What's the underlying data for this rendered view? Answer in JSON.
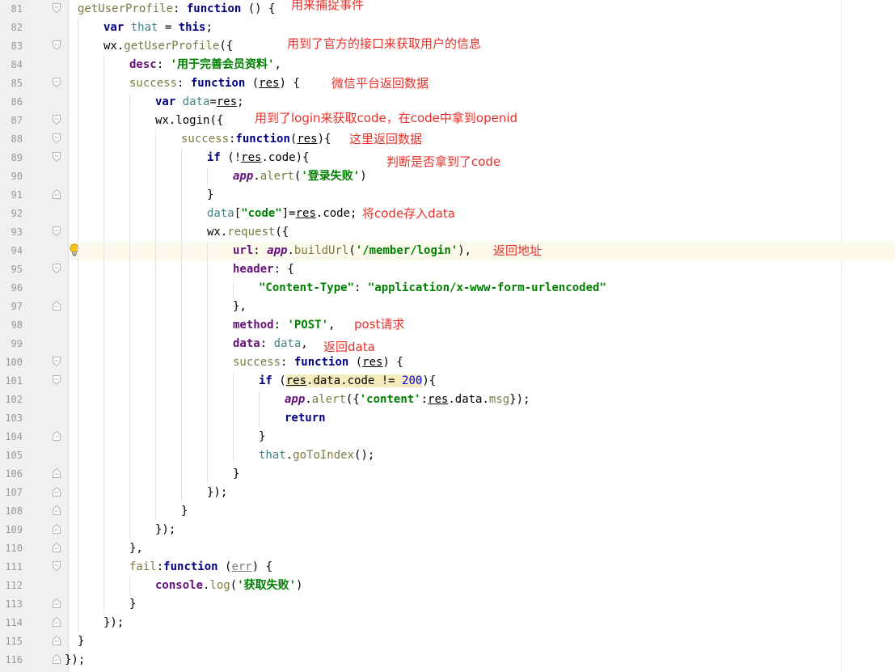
{
  "lines": [
    {
      "n": "81",
      "indent": 0,
      "tokens": [
        {
          "t": "getUserProfile",
          "c": "fn"
        },
        {
          "t": ": ",
          "c": "plain"
        },
        {
          "t": "function",
          "c": "kw"
        },
        {
          "t": " () {",
          "c": "plain"
        }
      ],
      "fold": "open"
    },
    {
      "n": "82",
      "indent": 1,
      "tokens": [
        {
          "t": "var ",
          "c": "kw"
        },
        {
          "t": "that",
          "c": "var"
        },
        {
          "t": " = ",
          "c": "plain"
        },
        {
          "t": "this",
          "c": "kw"
        },
        {
          "t": ";",
          "c": "plain"
        }
      ]
    },
    {
      "n": "83",
      "indent": 1,
      "tokens": [
        {
          "t": "wx.",
          "c": "plain"
        },
        {
          "t": "getUserProfile",
          "c": "meth"
        },
        {
          "t": "({",
          "c": "plain"
        }
      ],
      "fold": "open"
    },
    {
      "n": "84",
      "indent": 2,
      "tokens": [
        {
          "t": "desc",
          "c": "prop"
        },
        {
          "t": ": ",
          "c": "plain"
        },
        {
          "t": "'用于完善会员资料'",
          "c": "str"
        },
        {
          "t": ",",
          "c": "plain"
        }
      ]
    },
    {
      "n": "85",
      "indent": 2,
      "tokens": [
        {
          "t": "success",
          "c": "meth"
        },
        {
          "t": ": ",
          "c": "plain"
        },
        {
          "t": "function",
          "c": "kw"
        },
        {
          "t": " (",
          "c": "plain"
        },
        {
          "t": "res",
          "c": "ul"
        },
        {
          "t": ") {",
          "c": "plain"
        }
      ],
      "fold": "open"
    },
    {
      "n": "86",
      "indent": 3,
      "tokens": [
        {
          "t": "var ",
          "c": "kw"
        },
        {
          "t": "data",
          "c": "var"
        },
        {
          "t": "=",
          "c": "plain"
        },
        {
          "t": "res",
          "c": "ul"
        },
        {
          "t": ";",
          "c": "plain"
        }
      ]
    },
    {
      "n": "87",
      "indent": 3,
      "tokens": [
        {
          "t": "wx.login",
          "c": "plain"
        },
        {
          "t": "({",
          "c": "plain"
        }
      ],
      "fold": "open"
    },
    {
      "n": "88",
      "indent": 4,
      "tokens": [
        {
          "t": "success",
          "c": "meth"
        },
        {
          "t": ":",
          "c": "plain"
        },
        {
          "t": "function",
          "c": "kw"
        },
        {
          "t": "(",
          "c": "plain"
        },
        {
          "t": "res",
          "c": "ul"
        },
        {
          "t": "){",
          "c": "plain"
        }
      ],
      "fold": "open"
    },
    {
      "n": "89",
      "indent": 5,
      "tokens": [
        {
          "t": "if",
          "c": "kw"
        },
        {
          "t": " (!",
          "c": "plain"
        },
        {
          "t": "res",
          "c": "ul"
        },
        {
          "t": ".code){",
          "c": "plain"
        }
      ],
      "fold": "open"
    },
    {
      "n": "90",
      "indent": 6,
      "tokens": [
        {
          "t": "app",
          "c": "global"
        },
        {
          "t": ".",
          "c": "plain"
        },
        {
          "t": "alert",
          "c": "meth"
        },
        {
          "t": "(",
          "c": "plain"
        },
        {
          "t": "'登录失败'",
          "c": "str"
        },
        {
          "t": ")",
          "c": "plain"
        }
      ]
    },
    {
      "n": "91",
      "indent": 5,
      "tokens": [
        {
          "t": "}",
          "c": "plain"
        }
      ],
      "fold": "close"
    },
    {
      "n": "92",
      "indent": 5,
      "tokens": [
        {
          "t": "data",
          "c": "var"
        },
        {
          "t": "[",
          "c": "plain"
        },
        {
          "t": "\"code\"",
          "c": "str"
        },
        {
          "t": "]=",
          "c": "plain"
        },
        {
          "t": "res",
          "c": "ul"
        },
        {
          "t": ".code;",
          "c": "plain"
        }
      ]
    },
    {
      "n": "93",
      "indent": 5,
      "tokens": [
        {
          "t": "wx.",
          "c": "plain"
        },
        {
          "t": "request",
          "c": "meth"
        },
        {
          "t": "({",
          "c": "plain"
        }
      ],
      "fold": "open"
    },
    {
      "n": "94",
      "indent": 6,
      "tokens": [
        {
          "t": "url",
          "c": "prop"
        },
        {
          "t": ": ",
          "c": "plain"
        },
        {
          "t": "app",
          "c": "global"
        },
        {
          "t": ".",
          "c": "plain"
        },
        {
          "t": "buildUrl",
          "c": "meth"
        },
        {
          "t": "(",
          "c": "plain"
        },
        {
          "t": "'/member/login'",
          "c": "str"
        },
        {
          "t": "),",
          "c": "plain"
        }
      ],
      "highlight": true,
      "bulb": true
    },
    {
      "n": "95",
      "indent": 6,
      "tokens": [
        {
          "t": "header",
          "c": "prop"
        },
        {
          "t": ": {",
          "c": "plain"
        }
      ],
      "fold": "open"
    },
    {
      "n": "96",
      "indent": 7,
      "tokens": [
        {
          "t": "\"Content-Type\"",
          "c": "str"
        },
        {
          "t": ": ",
          "c": "plain"
        },
        {
          "t": "\"application/x-www-form-urlencoded\"",
          "c": "str"
        }
      ]
    },
    {
      "n": "97",
      "indent": 6,
      "tokens": [
        {
          "t": "},",
          "c": "plain"
        }
      ],
      "fold": "close"
    },
    {
      "n": "98",
      "indent": 6,
      "tokens": [
        {
          "t": "method",
          "c": "prop"
        },
        {
          "t": ": ",
          "c": "plain"
        },
        {
          "t": "'POST'",
          "c": "str"
        },
        {
          "t": ",",
          "c": "plain"
        }
      ]
    },
    {
      "n": "99",
      "indent": 6,
      "tokens": [
        {
          "t": "data",
          "c": "prop"
        },
        {
          "t": ": ",
          "c": "plain"
        },
        {
          "t": "data",
          "c": "var"
        },
        {
          "t": ",",
          "c": "plain"
        }
      ]
    },
    {
      "n": "100",
      "indent": 6,
      "tokens": [
        {
          "t": "success",
          "c": "meth"
        },
        {
          "t": ": ",
          "c": "plain"
        },
        {
          "t": "function",
          "c": "kw"
        },
        {
          "t": " (",
          "c": "plain"
        },
        {
          "t": "res",
          "c": "ul"
        },
        {
          "t": ") {",
          "c": "plain"
        }
      ],
      "fold": "open"
    },
    {
      "n": "101",
      "indent": 7,
      "tokens": [
        {
          "t": "if",
          "c": "kw"
        },
        {
          "t": " (",
          "c": "plain"
        },
        {
          "t": "res",
          "c": "ul hilite"
        },
        {
          "t": ".data.code != ",
          "c": "plain hilite"
        },
        {
          "t": "200",
          "c": "num hilite"
        },
        {
          "t": "){",
          "c": "plain"
        }
      ],
      "fold": "open"
    },
    {
      "n": "102",
      "indent": 8,
      "tokens": [
        {
          "t": "app",
          "c": "global"
        },
        {
          "t": ".",
          "c": "plain"
        },
        {
          "t": "alert",
          "c": "meth"
        },
        {
          "t": "({",
          "c": "plain"
        },
        {
          "t": "'content'",
          "c": "str"
        },
        {
          "t": ":",
          "c": "plain"
        },
        {
          "t": "res",
          "c": "ul"
        },
        {
          "t": ".data.",
          "c": "plain"
        },
        {
          "t": "msg",
          "c": "meth"
        },
        {
          "t": "});",
          "c": "plain"
        }
      ]
    },
    {
      "n": "103",
      "indent": 8,
      "tokens": [
        {
          "t": "return",
          "c": "kw"
        }
      ]
    },
    {
      "n": "104",
      "indent": 7,
      "tokens": [
        {
          "t": "}",
          "c": "plain"
        }
      ],
      "fold": "close"
    },
    {
      "n": "105",
      "indent": 7,
      "tokens": [
        {
          "t": "that",
          "c": "var"
        },
        {
          "t": ".",
          "c": "plain"
        },
        {
          "t": "goToIndex",
          "c": "meth"
        },
        {
          "t": "();",
          "c": "plain"
        }
      ]
    },
    {
      "n": "106",
      "indent": 6,
      "tokens": [
        {
          "t": "}",
          "c": "plain"
        }
      ],
      "fold": "close"
    },
    {
      "n": "107",
      "indent": 5,
      "tokens": [
        {
          "t": "});",
          "c": "plain"
        }
      ],
      "fold": "close"
    },
    {
      "n": "108",
      "indent": 4,
      "tokens": [
        {
          "t": "}",
          "c": "plain"
        }
      ],
      "fold": "close"
    },
    {
      "n": "109",
      "indent": 3,
      "tokens": [
        {
          "t": "});",
          "c": "plain"
        }
      ],
      "fold": "close"
    },
    {
      "n": "110",
      "indent": 2,
      "tokens": [
        {
          "t": "},",
          "c": "plain"
        }
      ],
      "fold": "close"
    },
    {
      "n": "111",
      "indent": 2,
      "tokens": [
        {
          "t": "fail",
          "c": "meth"
        },
        {
          "t": ":",
          "c": "plain"
        },
        {
          "t": "function",
          "c": "kw"
        },
        {
          "t": " (",
          "c": "plain"
        },
        {
          "t": "err",
          "c": "ul-gray"
        },
        {
          "t": ") {",
          "c": "plain"
        }
      ],
      "fold": "open"
    },
    {
      "n": "112",
      "indent": 3,
      "tokens": [
        {
          "t": "console",
          "c": "prop"
        },
        {
          "t": ".",
          "c": "plain"
        },
        {
          "t": "log",
          "c": "meth"
        },
        {
          "t": "(",
          "c": "plain"
        },
        {
          "t": "'获取失败'",
          "c": "str"
        },
        {
          "t": ")",
          "c": "plain"
        }
      ]
    },
    {
      "n": "113",
      "indent": 2,
      "tokens": [
        {
          "t": "}",
          "c": "plain"
        }
      ],
      "fold": "close"
    },
    {
      "n": "114",
      "indent": 1,
      "tokens": [
        {
          "t": "});",
          "c": "plain"
        }
      ],
      "fold": "close"
    },
    {
      "n": "115",
      "indent": 0,
      "tokens": [
        {
          "t": "}",
          "c": "plain"
        }
      ],
      "fold": "close"
    },
    {
      "n": "116",
      "indent": -0.5,
      "tokens": [
        {
          "t": "});",
          "c": "plain"
        }
      ],
      "fold": "close"
    }
  ],
  "annotations": [
    {
      "line": "81",
      "text": "用来捕捉事件"
    },
    {
      "line": "83",
      "text": "用到了官方的接口来获取用户的信息"
    },
    {
      "line": "85",
      "text": "微信平台返回数据"
    },
    {
      "line": "87",
      "text": "用到了login来获取code，在code中拿到openid"
    },
    {
      "line": "88",
      "text": "这里返回数据"
    },
    {
      "line": "89",
      "text": "判断是否拿到了code"
    },
    {
      "line": "92",
      "text": "将code存入data"
    },
    {
      "line": "94",
      "text": "返回地址"
    },
    {
      "line": "98",
      "text": "post请求"
    },
    {
      "line": "99",
      "text": "返回data"
    }
  ]
}
